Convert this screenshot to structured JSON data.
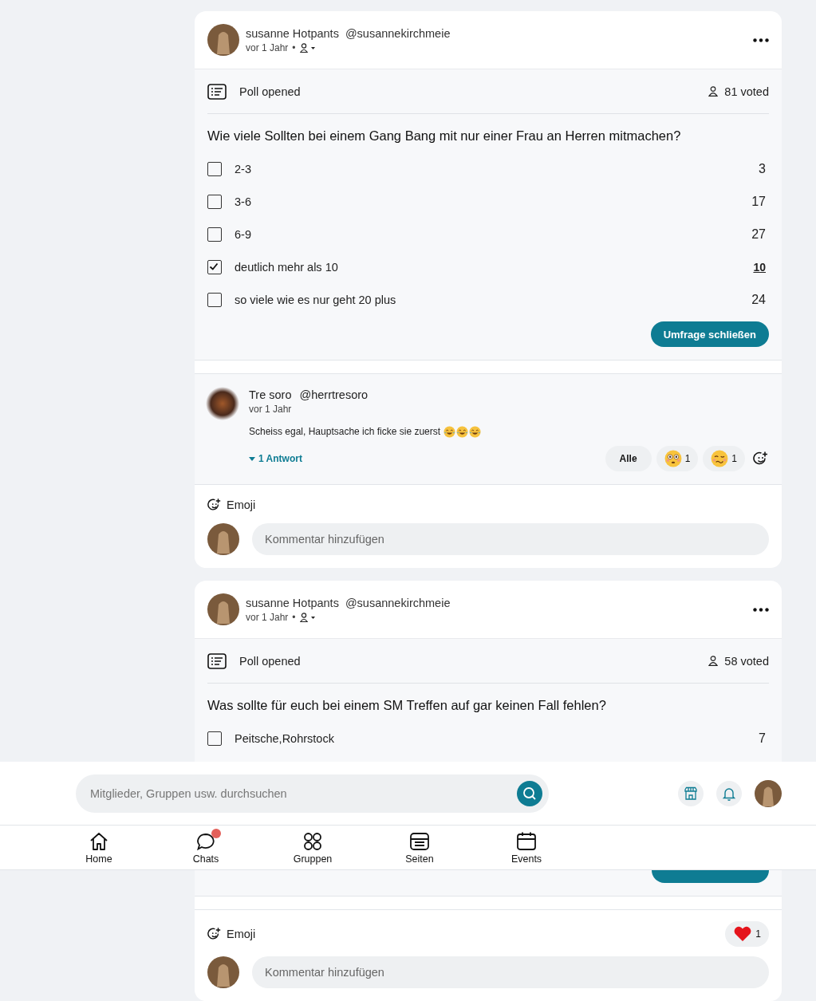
{
  "posts": [
    {
      "author": {
        "name": "susanne Hotpants",
        "handle": "@susannekirchmeie"
      },
      "time": "vor 1 Jahr",
      "separator": "•",
      "poll": {
        "status": "Poll opened",
        "voted": "81 voted",
        "question": "Wie viele Sollten bei einem Gang Bang mit nur einer Frau an Herren mitmachen?",
        "options": [
          {
            "label": "2-3",
            "count": "3",
            "selected": false
          },
          {
            "label": "3-6",
            "count": "17",
            "selected": false
          },
          {
            "label": "6-9",
            "count": "27",
            "selected": false
          },
          {
            "label": "deutlich mehr als 10",
            "count": "10",
            "selected": true
          },
          {
            "label": "so viele wie es nur geht 20 plus",
            "count": "24",
            "selected": false
          }
        ],
        "close_button": "Umfrage schließen"
      },
      "comments": [
        {
          "name": "Tre soro",
          "handle": "@herrtresoro",
          "time": "vor 1 Jahr",
          "text": "Scheiss egal, Hauptsache ich ficke sie zuerst",
          "emojis": [
            {
              "kind": "laughing"
            },
            {
              "kind": "laughing"
            },
            {
              "kind": "laughing"
            }
          ],
          "replies": "1 Antwort",
          "all_label": "Alle",
          "reactions": [
            {
              "kind": "flushed",
              "count": "1"
            },
            {
              "kind": "woozy",
              "count": "1"
            }
          ]
        }
      ],
      "emoji_label": "Emoji",
      "placeholder": "Kommentar hinzufügen"
    },
    {
      "author": {
        "name": "susanne Hotpants",
        "handle": "@susannekirchmeie"
      },
      "time": "vor 1 Jahr",
      "separator": "•",
      "poll": {
        "status": "Poll opened",
        "voted": "58 voted",
        "question": "Was sollte für euch bei einem SM Treffen auf gar keinen Fall fehlen?",
        "options": [
          {
            "label": "Peitsche,Rohrstock",
            "count": "7",
            "selected": false
          }
        ],
        "partial": true
      },
      "emoji_label": "Emoji",
      "reactions": [
        {
          "kind": "heart",
          "count": "1"
        }
      ],
      "placeholder": "Kommentar hinzufügen"
    }
  ],
  "search": {
    "placeholder": "Mitglieder, Gruppen usw. durchsuchen"
  },
  "nav": [
    {
      "kind": "home",
      "label": "Home",
      "badge": false
    },
    {
      "kind": "chat",
      "label": "Chats",
      "badge": true
    },
    {
      "kind": "groups",
      "label": "Gruppen",
      "badge": false
    },
    {
      "kind": "pages",
      "label": "Seiten",
      "badge": false
    },
    {
      "kind": "events",
      "label": "Events",
      "badge": false
    }
  ]
}
